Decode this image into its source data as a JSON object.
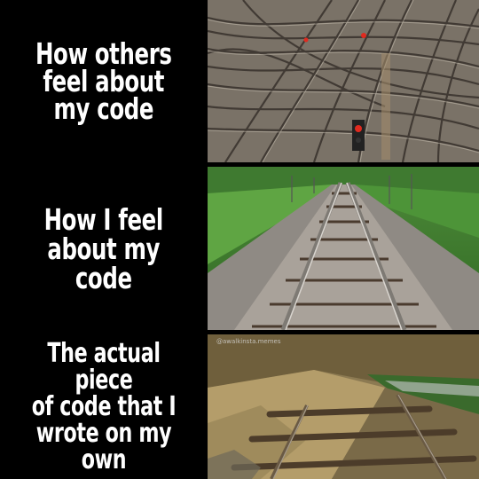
{
  "panels": [
    {
      "caption": "How others\nfeel about\nmy code"
    },
    {
      "caption": "How I feel\nabout my\ncode"
    },
    {
      "caption": "The actual piece\nof code that I\nwrote on my own"
    }
  ],
  "watermark": "@awalkinsta.memes",
  "icons": [
    "tangled-railway-photo",
    "straight-railway-photo",
    "broken-railway-photo"
  ]
}
